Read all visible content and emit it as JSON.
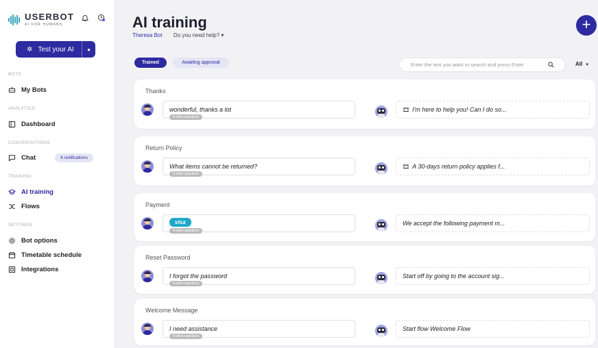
{
  "sidebar": {
    "logo_name": "USERBOT",
    "logo_tag": "AI FOR HUMANS",
    "test_button": "Test your AI",
    "sections": {
      "bots": "BOTS",
      "analytics": "ANALYTICS",
      "conversations": "CONVERSATIONS",
      "training": "TRAINING",
      "settings": "SETTINGS"
    },
    "items": {
      "my_bots": "My Bots",
      "dashboard": "Dashboard",
      "chat": "Chat",
      "chat_badge": "4 notifications",
      "ai_training": "AI training",
      "flows": "Flows",
      "bot_options": "Bot options",
      "timetable": "Timetable schedule",
      "integrations": "Integrations"
    }
  },
  "header": {
    "title": "AI training",
    "bot_name": "Theresa Bot",
    "help": "Do you need help? ▾",
    "add_button": "+"
  },
  "tabs": {
    "trained": "Trained",
    "awaiting": "Awaiting approval"
  },
  "search": {
    "placeholder": "Enter the text you want to search and press Enter",
    "value": ""
  },
  "filter": {
    "value": "All"
  },
  "cards": [
    {
      "title": "Thanks",
      "question": "wonderful, thanks a lot",
      "other": "4 other questions",
      "answer": "I'm here to help you! Can I do so...",
      "answer_icon": "film-icon"
    },
    {
      "title": "Return Policy",
      "question": "What items cannot be returned?",
      "other": "3 other questions",
      "answer": "A 30-days return policy applies f...",
      "answer_icon": "film-icon"
    },
    {
      "title": "Payment",
      "question": "visa",
      "other": "4 other questions",
      "answer": "We accept the following payment m..."
    },
    {
      "title": "Reset Password",
      "question": "I forgot the password",
      "other": "6 other questions",
      "answer": "Start off by going to the account sig..."
    },
    {
      "title": "Welcome Message",
      "question": "I need assistance",
      "other": "4 other questions",
      "answer": "Start flow Welcome Flow"
    }
  ],
  "colors": {
    "primary": "#2e2aa0",
    "accent_light": "#e4e6f5",
    "visa": "#1fa9c9"
  }
}
